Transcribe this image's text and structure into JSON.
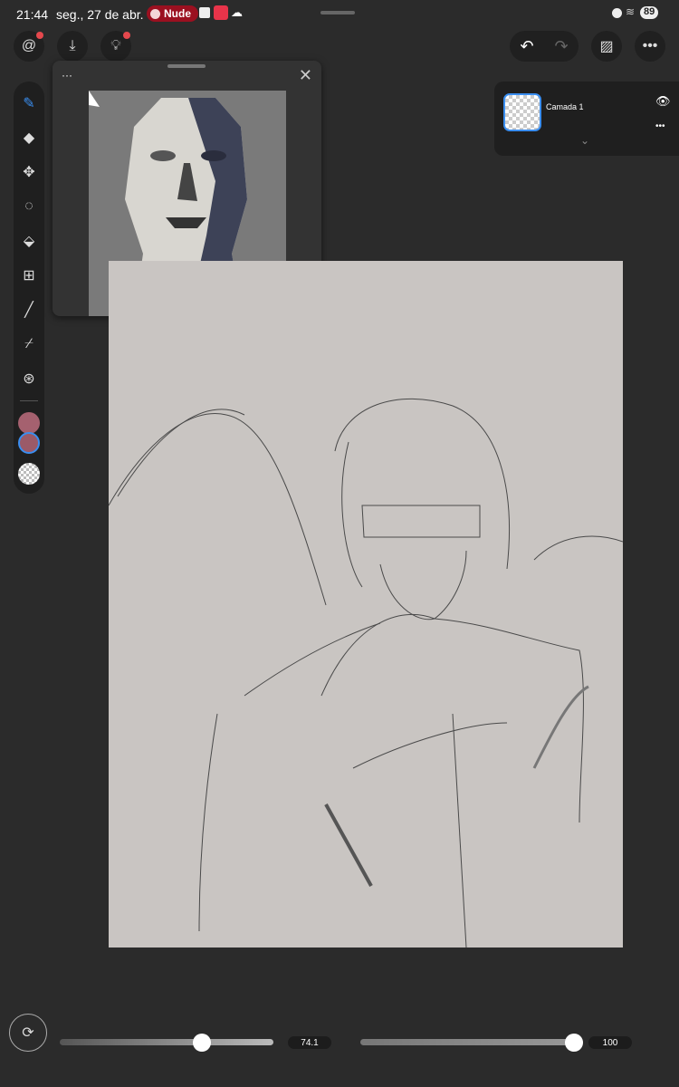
{
  "status_bar": {
    "time": "21:44",
    "date": "seg., 27 de abr.",
    "media_label": "Nude",
    "battery": "89"
  },
  "toolbar": {
    "left_buttons": [
      "app-logo",
      "import",
      "tips"
    ],
    "right_buttons": [
      "undo",
      "redo",
      "gallery",
      "more"
    ]
  },
  "tools": [
    "brush",
    "eraser",
    "move",
    "lasso",
    "fill",
    "transform",
    "line",
    "eyedropper",
    "color-blend"
  ],
  "colors": {
    "primary": "#a5616f",
    "secondary": "#9b5a68",
    "accent": "#3a8ef0"
  },
  "reference_panel": {
    "menu_label": "···"
  },
  "layers": [
    {
      "name": "Camada 1",
      "visible": true
    }
  ],
  "sliders": {
    "size": {
      "value": "74.1",
      "fraction": 0.66
    },
    "opacity": {
      "value": "100",
      "fraction": 1.0
    }
  }
}
